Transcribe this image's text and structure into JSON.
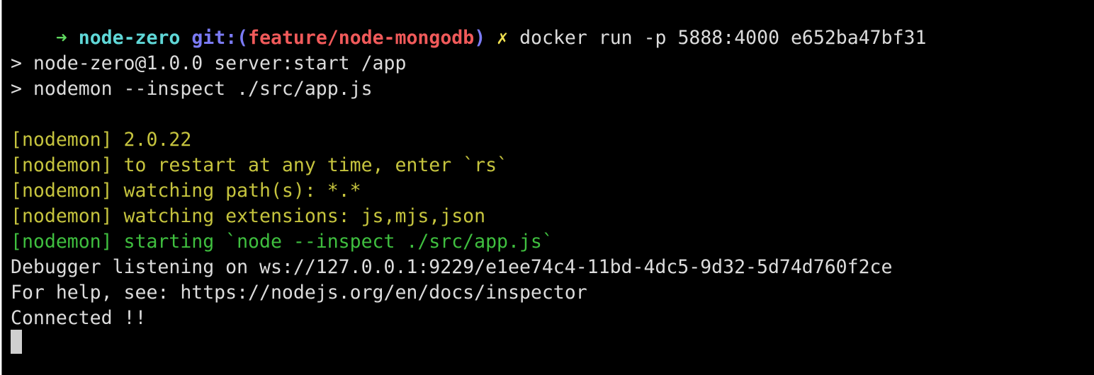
{
  "prompt": {
    "arrow": "➜",
    "directory": "node-zero",
    "git_label": "git:(",
    "branch": "feature/node-mongodb",
    "git_close": ")",
    "dirty_marker": "✗",
    "command": "docker run -p 5888:4000 e652ba47bf31"
  },
  "output": [
    {
      "text": "> node-zero@1.0.0 server:start /app",
      "color": "white"
    },
    {
      "text": "> nodemon --inspect ./src/app.js",
      "color": "white"
    },
    {
      "text": "",
      "color": "white"
    },
    {
      "text": "[nodemon] 2.0.22",
      "color": "yellow"
    },
    {
      "text": "[nodemon] to restart at any time, enter `rs`",
      "color": "yellow"
    },
    {
      "text": "[nodemon] watching path(s): *.*",
      "color": "yellow"
    },
    {
      "text": "[nodemon] watching extensions: js,mjs,json",
      "color": "yellow"
    },
    {
      "text": "[nodemon] starting `node --inspect ./src/app.js`",
      "color": "green"
    },
    {
      "text": "Debugger listening on ws://127.0.0.1:9229/e1ee74c4-11bd-4dc5-9d32-5d74d760f2ce",
      "color": "white"
    },
    {
      "text": "For help, see: https://nodejs.org/en/docs/inspector",
      "color": "white"
    },
    {
      "text": "Connected !!",
      "color": "white"
    }
  ],
  "colors": {
    "background": "#000000",
    "yellow": "#c6c43e",
    "green": "#3fbf3f",
    "white": "#dcdcdc"
  }
}
